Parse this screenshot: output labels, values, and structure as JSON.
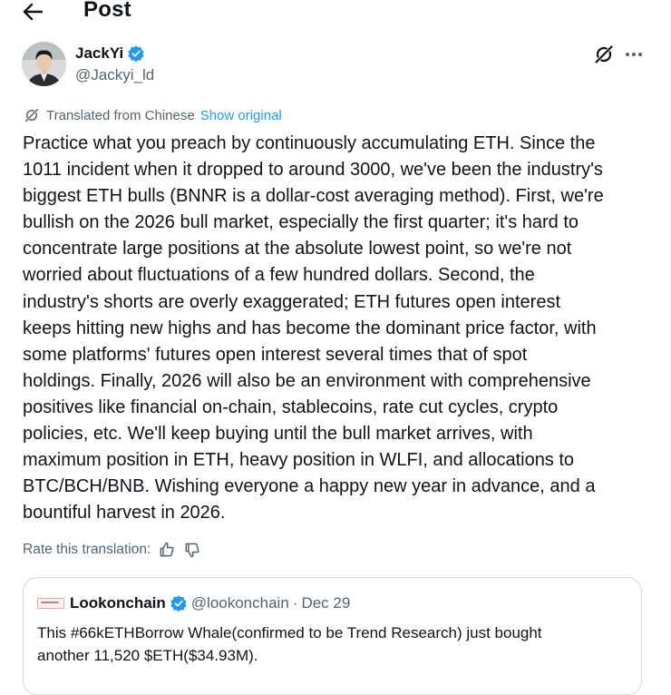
{
  "header": {
    "title": "Post",
    "back_icon": "arrow-left-icon"
  },
  "author": {
    "name": "JackYi",
    "handle": "@Jackyi_ld",
    "verified": true
  },
  "translation": {
    "label": "Translated from Chinese",
    "show_original": "Show original"
  },
  "post": {
    "text": "Practice what you preach by continuously accumulating ETH. Since the\n1011 incident when it dropped to around 3000, we've been the industry's\nbiggest ETH bulls (BNNR is a dollar-cost averaging method). First, we're\nbullish on the 2026 bull market, especially the first quarter; it's hard to\nconcentrate large positions at the absolute lowest point, so we're not\nworried about fluctuations of a few hundred dollars. Second, the\nindustry's shorts are overly exaggerated; ETH futures open interest\nkeeps hitting new highs and has become the dominant price factor, with\nsome platforms' futures open interest several times that of spot\nholdings. Finally, 2026 will also be an environment with comprehensive\npositives like financial on-chain, stablecoins, rate cut cycles, crypto\npolicies, etc. We'll keep buying until the bull market arrives, with\nmaximum position in ETH, heavy position in WLFI, and allocations to\nBTC/BCH/BNB. Wishing everyone a happy new year in advance, and a\nbountiful harvest in 2026."
  },
  "rate": {
    "label": "Rate this translation:"
  },
  "quote": {
    "name": "Lookonchain",
    "handle": "@lookonchain",
    "separator": "·",
    "date": "Dec 29",
    "text": "This #66kETHBorrow Whale(confirmed to be Trend Research) just bought\nanother 11,520 $ETH($34.93M)."
  },
  "colors": {
    "accent": "#1d9bf0",
    "text": "#0f1419",
    "secondary": "#536471",
    "border": "#cfd9de"
  }
}
